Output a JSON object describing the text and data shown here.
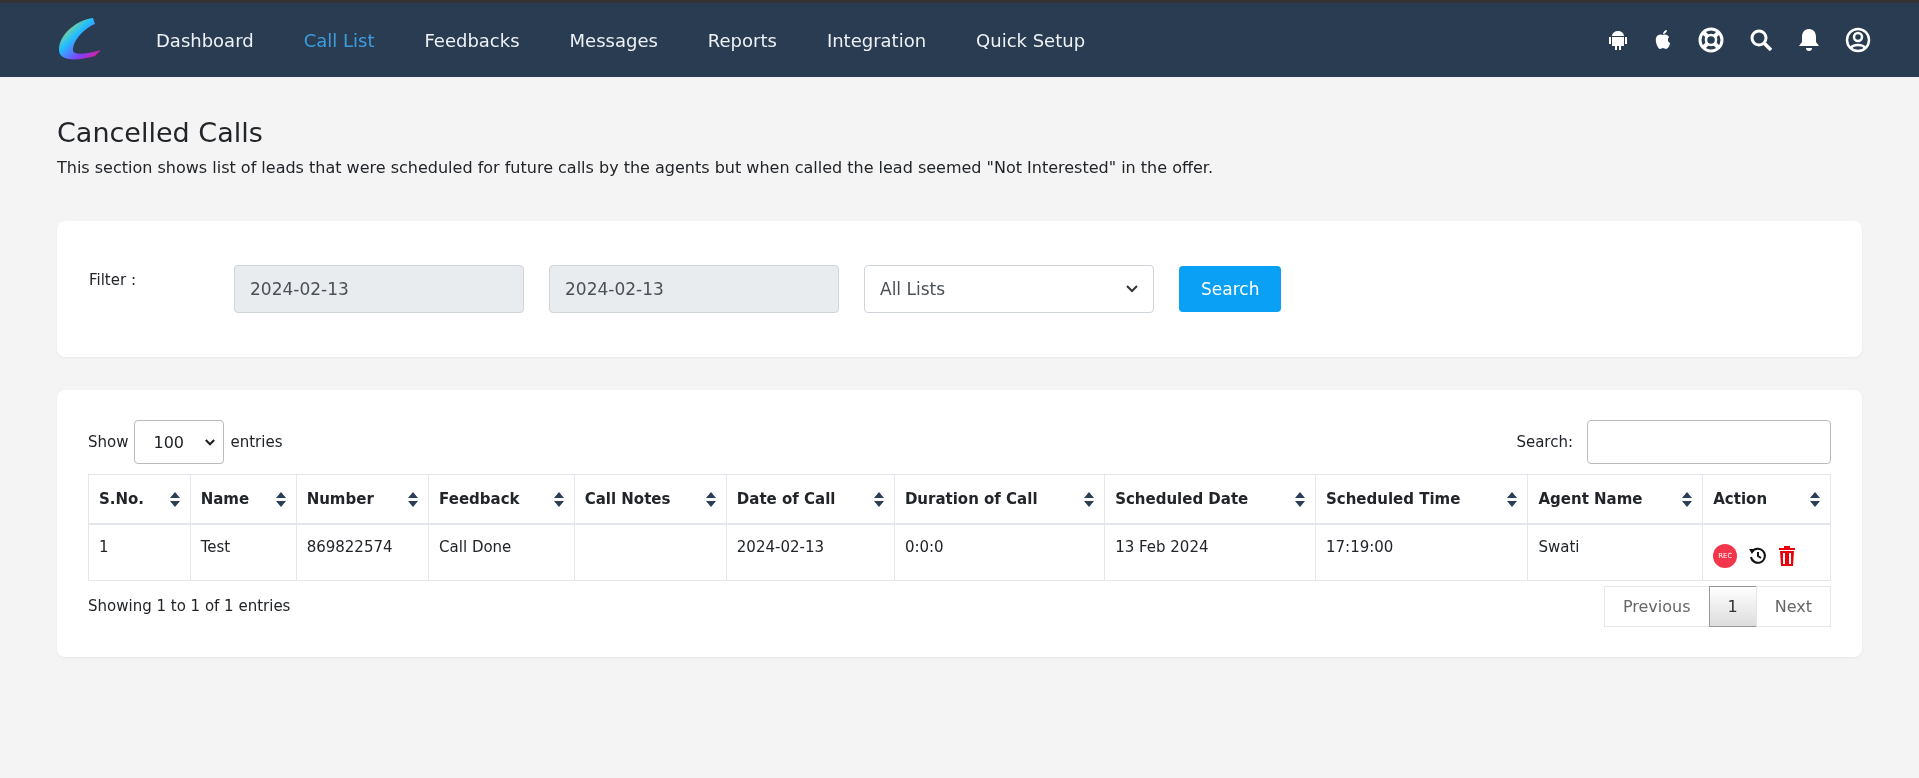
{
  "nav": {
    "items": [
      {
        "label": "Dashboard",
        "selected": false
      },
      {
        "label": "Call List",
        "selected": true
      },
      {
        "label": "Feedbacks",
        "selected": false
      },
      {
        "label": "Messages",
        "selected": false
      },
      {
        "label": "Reports",
        "selected": false
      },
      {
        "label": "Integration",
        "selected": false
      },
      {
        "label": "Quick Setup",
        "selected": false
      }
    ],
    "icons": [
      {
        "kind": "android"
      },
      {
        "kind": "apple"
      },
      {
        "kind": "support"
      },
      {
        "kind": "search"
      },
      {
        "kind": "bell"
      },
      {
        "kind": "user"
      }
    ]
  },
  "page": {
    "title": "Cancelled Calls",
    "description": "This section shows list of leads that were scheduled for future calls by the agents but when called the lead seemed \"Not Interested\" in the offer."
  },
  "filter": {
    "label": "Filter :",
    "date_from": "2024-02-13",
    "date_to": "2024-02-13",
    "list_select": "All Lists",
    "button": "Search"
  },
  "table": {
    "show_label": "Show",
    "page_size": "100",
    "entries_label": "entries",
    "search_label": "Search:",
    "columns": [
      "S.No.",
      "Name",
      "Number",
      "Feedback",
      "Call Notes",
      "Date of Call",
      "Duration of Call",
      "Scheduled Date",
      "Scheduled Time",
      "Agent Name",
      "Action"
    ],
    "rows": [
      {
        "cells": [
          "1",
          "Test",
          "869822574",
          "Call Done",
          "",
          "2024-02-13",
          "0:0:0",
          "13 Feb 2024",
          "17:19:00",
          "Swati"
        ],
        "actions": [
          {
            "kind": "rec",
            "label": "REC"
          },
          {
            "kind": "history"
          },
          {
            "kind": "delete"
          }
        ]
      }
    ],
    "info": "Showing 1 to 1 of 1 entries",
    "pagination": [
      {
        "label": "Previous",
        "selected": false
      },
      {
        "label": "1",
        "selected": true
      },
      {
        "label": "Next",
        "selected": false
      }
    ]
  }
}
